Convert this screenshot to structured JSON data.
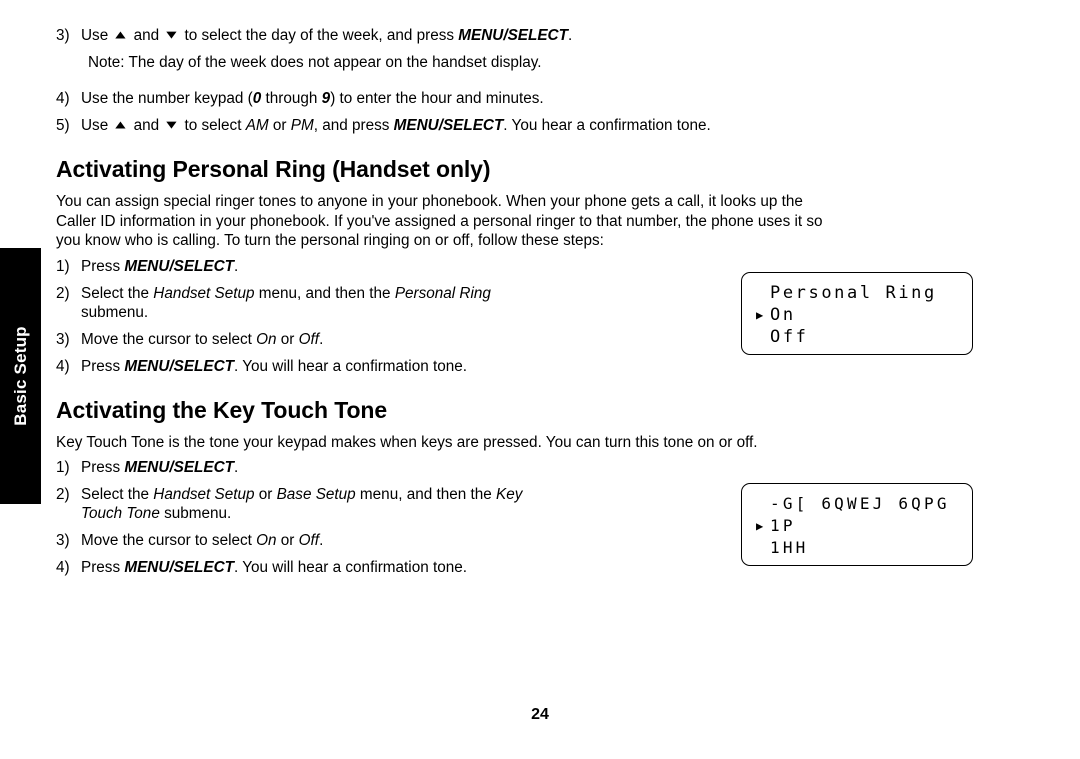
{
  "page": {
    "number": "24",
    "side_tab_label": "Basic Setup"
  },
  "top_steps": [
    {
      "num": "3)",
      "pre": "Use ",
      "mid": " and ",
      "post": " to select the day of the week, and press ",
      "key": "MENU/SELECT",
      "tail": "."
    },
    {
      "num": "",
      "note": "Note: The day of the week does not appear on the handset display."
    },
    {
      "num": "4)",
      "text_a": "Use the number keypad (",
      "em_a": "0",
      "text_b": " through ",
      "em_b": "9",
      "text_c": ") to enter the hour and minutes."
    },
    {
      "num": "5)",
      "pre": "Use ",
      "mid": " and ",
      "post": " to select ",
      "em_a": "AM",
      "mid2": " or ",
      "em_b": "PM",
      "post2": ", and press ",
      "key": "MENU/SELECT",
      "tail": ". You hear a confirmation tone."
    }
  ],
  "sections": [
    {
      "heading": "Activating Personal Ring (Handset only)",
      "intro_lines": [
        "You can assign special ringer tones to anyone in your phonebook. When your phone gets a call, it looks up the",
        "Caller ID information in your phonebook. If you've assigned a personal ringer to that number, the phone uses it so",
        "you know who is calling. To turn the personal ringing on or off, follow these steps:"
      ],
      "steps": [
        {
          "num": "1)",
          "lead": "Press ",
          "key": "MENU/SELECT",
          "tail": "."
        },
        {
          "num": "2)",
          "lead": "Select the ",
          "em_a": "Handset Setup",
          "mid": " menu, and then the ",
          "em_b": "Personal Ring",
          "tail": "",
          "second_line": "submenu."
        },
        {
          "num": "3)",
          "lead": "Move the cursor to select ",
          "em_a": "On",
          "mid": " or ",
          "em_b": "Off",
          "tail": "."
        },
        {
          "num": "4)",
          "lead": "Press ",
          "key": "MENU/SELECT",
          "tail": ". You will hear a confirmation tone."
        }
      ]
    },
    {
      "heading": "Activating the Key Touch Tone",
      "intro_lines": [
        "Key Touch Tone is the tone your keypad makes when keys are pressed. You can turn this tone on or off."
      ],
      "steps": [
        {
          "num": "1)",
          "lead": "Press ",
          "key": "MENU/SELECT",
          "tail": "."
        },
        {
          "num": "2)",
          "lead": "Select the ",
          "em_a": "Handset Setup",
          "mid": " or ",
          "em_b": "Base Setup",
          "mid2": " menu, and then the ",
          "em_c": "Key",
          "second_line_em": "Touch Tone",
          "second_line_tail": " submenu."
        },
        {
          "num": "3)",
          "lead": "Move the cursor to select ",
          "em_a": "On",
          "mid": " or ",
          "em_b": "Off",
          "tail": "."
        },
        {
          "num": "4)",
          "lead": "Press ",
          "key": "MENU/SELECT",
          "tail": ". You will hear a confirmation tone."
        }
      ]
    }
  ],
  "lcd_screens": [
    {
      "id": "personal-ring",
      "title": "Personal Ring",
      "cursor": "▶",
      "selected_option": "On",
      "other_option": "Off"
    },
    {
      "id": "key-touch",
      "title": "-G[ 6QWEJ 6QPG",
      "cursor": "▶",
      "selected_option": "1P",
      "other_option": "1HH"
    }
  ],
  "glyphs": {
    "up_triangle": "▲",
    "down_triangle": "▼"
  }
}
